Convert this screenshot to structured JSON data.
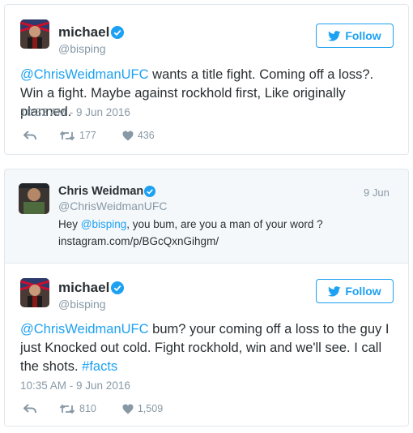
{
  "tweet1": {
    "name": "michael",
    "handle": "@bisping",
    "follow_label": "Follow",
    "text_mention": "@ChrisWeidmanUFC",
    "text_body": " wants a title fight. Coming off a loss?. Win a fight. Maybe against rockhold first, Like originally planned.",
    "timestamp": "10:32 AM - 9 Jun 2016",
    "retweets": "177",
    "likes": "436"
  },
  "quoted": {
    "name": "Chris Weidman",
    "handle": "@ChrisWeidmanUFC",
    "date": "9 Jun",
    "text_prefix": "Hey ",
    "text_mention": "@bisping",
    "text_body": ", you bum, are you a man of your word ?",
    "link": "instagram.com/p/BGcQxnGihgm/"
  },
  "tweet2": {
    "name": "michael",
    "handle": "@bisping",
    "follow_label": "Follow",
    "text_mention": "@ChrisWeidmanUFC",
    "text_body": " bum? your coming off a loss to the guy I just Knocked out cold. Fight rockhold, win and we'll see. I call the shots. ",
    "text_hashtag": "#facts",
    "timestamp": "10:35 AM - 9 Jun 2016",
    "retweets": "810",
    "likes": "1,509"
  },
  "colors": {
    "accent": "#1da1f2",
    "text": "#292f33",
    "muted": "#8899a6",
    "border": "#e1e8ed"
  },
  "icons": [
    "verified-icon",
    "twitter-bird-icon",
    "reply-icon",
    "retweet-icon",
    "like-icon"
  ]
}
